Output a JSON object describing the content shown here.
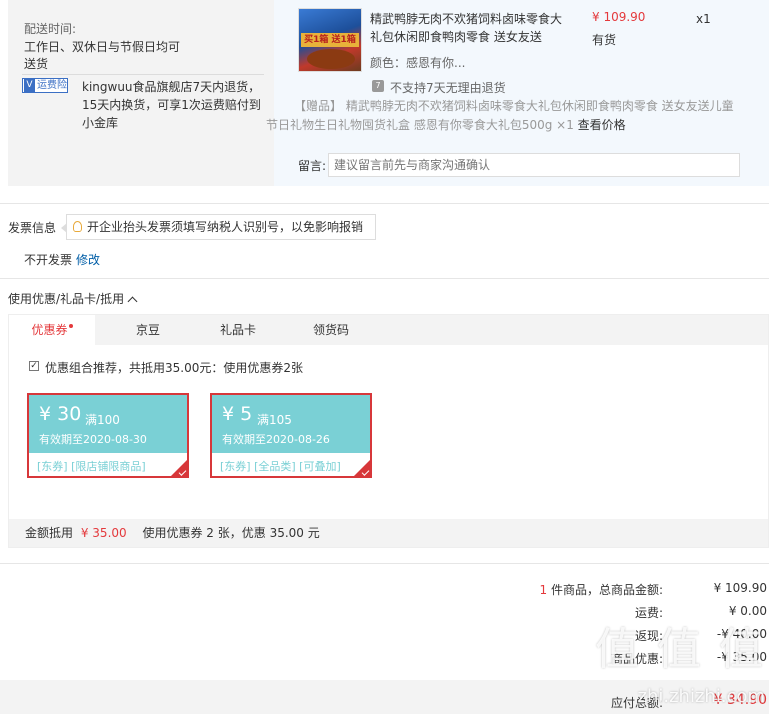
{
  "order": {
    "delivery_label": "配送时间:",
    "delivery_lines": [
      "工作日、双休日与节假日均可",
      "送货"
    ],
    "insurance_badge": "运费险",
    "insurance_lines": [
      "kingwuu食品旗舰店7天内退货，",
      "15天内换货，可享1次运费赔付到",
      "小金库"
    ],
    "item": {
      "thumb_banner": "买1箱 送1箱",
      "title_lines": [
        "精武鸭脖无肉不欢猪饲料卤味零食大",
        "礼包休闲即食鸭肉零食 送女友送"
      ],
      "color": "颜色：感恩有你...",
      "price": "¥ 109.90",
      "stock": "有货",
      "quantity": "x1",
      "no_return_icon": "7",
      "no_return": "不支持7天无理由退货"
    },
    "gift": {
      "tag": "【赠品】",
      "lines": [
        "精武鸭脖无肉不欢猪饲料卤味零食大礼包休闲即食鸭肉零食 送女友送儿童",
        "节日礼物生日礼物囤货礼盒 感恩有你零食大礼包500g ×1"
      ],
      "check_price": "查看价格"
    },
    "remark": {
      "label": "留言:",
      "placeholder": "建议留言前先与商家沟通确认"
    }
  },
  "invoice": {
    "title": "发票信息",
    "tip": "开企业抬头发票须填写纳税人识别号，以免影响报销",
    "value": "不开发票",
    "edit": "修改"
  },
  "coupon": {
    "title": "使用优惠/礼品卡/抵用",
    "tabs": [
      {
        "label": "优惠券",
        "active": true
      },
      {
        "label": "京豆",
        "active": false
      },
      {
        "label": "礼品卡",
        "active": false
      },
      {
        "label": "领货码",
        "active": false
      }
    ],
    "combo_text": "优惠组合推荐，共抵用35.00元：使用优惠券2张",
    "cards": [
      {
        "amount": "¥ 30",
        "condition": "满100",
        "valid": "有效期至2020-08-30",
        "tags": "[东券] [限店铺限商品]"
      },
      {
        "amount": "¥ 5",
        "condition": "满105",
        "valid": "有效期至2020-08-26",
        "tags": "[东券] [全品类] [可叠加]"
      }
    ],
    "deduct_label": "金额抵用",
    "deduct_amount": "¥ 35.00",
    "deduct_desc": "使用优惠券 2 张，优惠 35.00 元"
  },
  "summary": {
    "item_count": "1",
    "item_label": "件商品，总商品金额:",
    "item_total": "¥ 109.90",
    "freight_label": "运费:",
    "freight": "¥ 0.00",
    "cashback_label": "返现:",
    "cashback": "-¥ 40.00",
    "discount_label": "商品优惠:",
    "discount": "-¥ 35.00",
    "payable_label": "应付总额:",
    "payable": "¥ 34.90"
  },
  "watermark": {
    "logo": "值 值 值",
    "url": "zhi.zhizhi.com"
  }
}
